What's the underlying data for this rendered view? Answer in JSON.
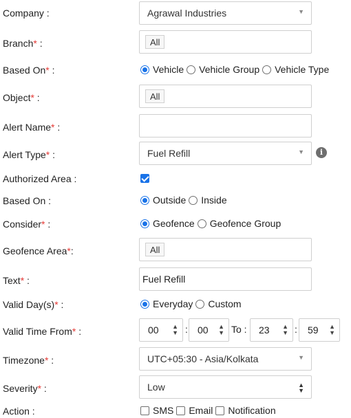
{
  "company": {
    "label": "Company :",
    "value": "Agrawal Industries"
  },
  "branch": {
    "label": "Branch",
    "required": "*",
    "colon": " :",
    "tag": "All"
  },
  "based_on": {
    "label": "Based On",
    "required": "*",
    "colon": " :",
    "options": [
      "Vehicle",
      "Vehicle Group",
      "Vehicle Type"
    ],
    "selected": 0
  },
  "object": {
    "label": "Object",
    "required": "*",
    "colon": " :",
    "tag": "All"
  },
  "alert_name": {
    "label": "Alert Name",
    "required": "*",
    "colon": " :",
    "value": ""
  },
  "alert_type": {
    "label": "Alert Type",
    "required": "*",
    "colon": " :",
    "value": "Fuel Refill",
    "info_icon": "info-icon"
  },
  "authorized_area": {
    "label": "Authorized Area :",
    "checked": true
  },
  "based_on_area": {
    "label": "Based On :",
    "options": [
      "Outside",
      "Inside"
    ],
    "selected": 0
  },
  "consider": {
    "label": "Consider",
    "required": "*",
    "colon": " :",
    "options": [
      "Geofence",
      "Geofence Group"
    ],
    "selected": 0
  },
  "geofence_area": {
    "label": "Geofence Area",
    "required": "*",
    "colon": ":",
    "tag": "All"
  },
  "text": {
    "label": "Text",
    "required": "*",
    "colon": " :",
    "value": "Fuel Refill"
  },
  "valid_days": {
    "label": "Valid Day(s)",
    "required": "*",
    "colon": " :",
    "options": [
      "Everyday",
      "Custom"
    ],
    "selected": 0
  },
  "valid_time": {
    "label": "Valid Time From",
    "required": "*",
    "colon": " :",
    "from_hour": "00",
    "from_minute": "00",
    "to_label": "To :",
    "to_hour": "23",
    "to_minute": "59",
    "separator": ":"
  },
  "timezone": {
    "label": "Timezone",
    "required": "*",
    "colon": " :",
    "value": "UTC+05:30 - Asia/Kolkata"
  },
  "severity": {
    "label": "Severity",
    "required": "*",
    "colon": " :",
    "value": "Low"
  },
  "action": {
    "label": "Action :",
    "options": [
      "SMS",
      "Email",
      "Notification"
    ]
  },
  "colors": {
    "accent": "#1a73e8",
    "required": "#e53935",
    "border": "#cfcfcf"
  }
}
